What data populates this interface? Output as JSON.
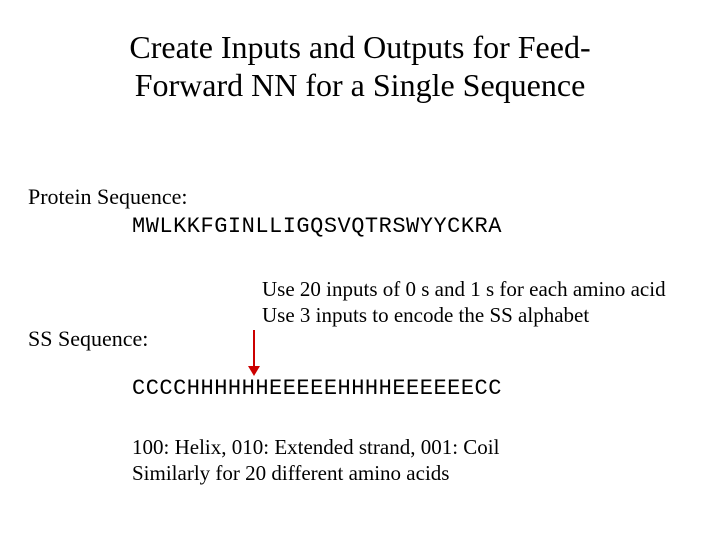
{
  "title": {
    "line1": "Create Inputs and Outputs for Feed-",
    "line2": "Forward NN for a Single Sequence"
  },
  "protein": {
    "label": "Protein Sequence:",
    "sequence": "MWLKKFGINLLIGQSVQTRSWYYCKRA"
  },
  "notes": {
    "line1": "Use 20 inputs of 0 s and 1 s for each amino acid",
    "line2": "Use 3 inputs to encode the SS alphabet"
  },
  "ss": {
    "label": "SS Sequence:",
    "sequence": "CCCCHHHHHHEEEEEHHHHEEEEEECC"
  },
  "legend": {
    "line1": "100: Helix, 010: Extended strand, 001: Coil",
    "line2": "Similarly for 20 different amino acids"
  }
}
